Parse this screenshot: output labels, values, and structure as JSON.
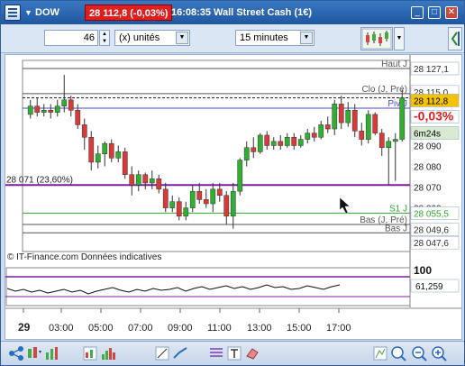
{
  "titlebar": {
    "symbol": "DOW",
    "price_change": "28 112,8 (-0,03%)",
    "time": "16:08:35",
    "name": "Wall Street Cash (1€)"
  },
  "toolbar": {
    "quantity": "46",
    "units": "(x) unités",
    "period": "15 minutes"
  },
  "chart_data": {
    "type": "candlestick",
    "x_ticks": [
      "29",
      "03:00",
      "05:00",
      "07:00",
      "09:00",
      "11:00",
      "13:00",
      "15:00",
      "17:00"
    ],
    "y_ticks": [
      "28 090",
      "28 080",
      "28 070",
      "28 060"
    ],
    "ylim": [
      28039,
      28131
    ],
    "candles": [
      {
        "o": 28105,
        "h": 28112,
        "l": 28103,
        "c": 28109
      },
      {
        "o": 28109,
        "h": 28113,
        "l": 28104,
        "c": 28106
      },
      {
        "o": 28106,
        "h": 28110,
        "l": 28104,
        "c": 28107
      },
      {
        "o": 28107,
        "h": 28110,
        "l": 28103,
        "c": 28106
      },
      {
        "o": 28106,
        "h": 28112,
        "l": 28104,
        "c": 28109
      },
      {
        "o": 28109,
        "h": 28124,
        "l": 28106,
        "c": 28112
      },
      {
        "o": 28112,
        "h": 28114,
        "l": 28104,
        "c": 28107
      },
      {
        "o": 28107,
        "h": 28110,
        "l": 28098,
        "c": 28100
      },
      {
        "o": 28100,
        "h": 28103,
        "l": 28088,
        "c": 28094
      },
      {
        "o": 28094,
        "h": 28097,
        "l": 28078,
        "c": 28082
      },
      {
        "o": 28082,
        "h": 28090,
        "l": 28079,
        "c": 28086
      },
      {
        "o": 28086,
        "h": 28092,
        "l": 28080,
        "c": 28091
      },
      {
        "o": 28091,
        "h": 28093,
        "l": 28082,
        "c": 28084
      },
      {
        "o": 28084,
        "h": 28090,
        "l": 28082,
        "c": 28087
      },
      {
        "o": 28087,
        "h": 28089,
        "l": 28074,
        "c": 28076
      },
      {
        "o": 28076,
        "h": 28080,
        "l": 28066,
        "c": 28071
      },
      {
        "o": 28071,
        "h": 28078,
        "l": 28068,
        "c": 28076
      },
      {
        "o": 28076,
        "h": 28077,
        "l": 28069,
        "c": 28072
      },
      {
        "o": 28072,
        "h": 28078,
        "l": 28069,
        "c": 28074
      },
      {
        "o": 28074,
        "h": 28076,
        "l": 28067,
        "c": 28069
      },
      {
        "o": 28069,
        "h": 28072,
        "l": 28058,
        "c": 28060
      },
      {
        "o": 28060,
        "h": 28066,
        "l": 28058,
        "c": 28063
      },
      {
        "o": 28063,
        "h": 28065,
        "l": 28054,
        "c": 28056
      },
      {
        "o": 28056,
        "h": 28063,
        "l": 28054,
        "c": 28060
      },
      {
        "o": 28060,
        "h": 28071,
        "l": 28058,
        "c": 28068
      },
      {
        "o": 28068,
        "h": 28072,
        "l": 28062,
        "c": 28064
      },
      {
        "o": 28064,
        "h": 28069,
        "l": 28060,
        "c": 28062
      },
      {
        "o": 28062,
        "h": 28072,
        "l": 28058,
        "c": 28069
      },
      {
        "o": 28069,
        "h": 28072,
        "l": 28063,
        "c": 28066
      },
      {
        "o": 28066,
        "h": 28068,
        "l": 28052,
        "c": 28056
      },
      {
        "o": 28056,
        "h": 28072,
        "l": 28050,
        "c": 28068
      },
      {
        "o": 28068,
        "h": 28084,
        "l": 28066,
        "c": 28083
      },
      {
        "o": 28083,
        "h": 28092,
        "l": 28080,
        "c": 28089
      },
      {
        "o": 28089,
        "h": 28094,
        "l": 28084,
        "c": 28087
      },
      {
        "o": 28087,
        "h": 28096,
        "l": 28086,
        "c": 28095
      },
      {
        "o": 28095,
        "h": 28097,
        "l": 28088,
        "c": 28090
      },
      {
        "o": 28090,
        "h": 28094,
        "l": 28088,
        "c": 28092
      },
      {
        "o": 28092,
        "h": 28095,
        "l": 28088,
        "c": 28090
      },
      {
        "o": 28090,
        "h": 28096,
        "l": 28089,
        "c": 28094
      },
      {
        "o": 28094,
        "h": 28096,
        "l": 28088,
        "c": 28090
      },
      {
        "o": 28090,
        "h": 28095,
        "l": 28089,
        "c": 28093
      },
      {
        "o": 28093,
        "h": 28098,
        "l": 28091,
        "c": 28096
      },
      {
        "o": 28096,
        "h": 28099,
        "l": 28092,
        "c": 28094
      },
      {
        "o": 28094,
        "h": 28102,
        "l": 28093,
        "c": 28100
      },
      {
        "o": 28100,
        "h": 28104,
        "l": 28096,
        "c": 28098
      },
      {
        "o": 28098,
        "h": 28112,
        "l": 28095,
        "c": 28110
      },
      {
        "o": 28110,
        "h": 28114,
        "l": 28098,
        "c": 28101
      },
      {
        "o": 28101,
        "h": 28111,
        "l": 28099,
        "c": 28107
      },
      {
        "o": 28107,
        "h": 28110,
        "l": 28094,
        "c": 28097
      },
      {
        "o": 28097,
        "h": 28101,
        "l": 28090,
        "c": 28093
      },
      {
        "o": 28093,
        "h": 28107,
        "l": 28091,
        "c": 28105
      },
      {
        "o": 28105,
        "h": 28106,
        "l": 28095,
        "c": 28096
      },
      {
        "o": 28096,
        "h": 28098,
        "l": 28085,
        "c": 28089
      },
      {
        "o": 28089,
        "h": 28094,
        "l": 28071,
        "c": 28092
      },
      {
        "o": 28092,
        "h": 28096,
        "l": 28073,
        "c": 28093
      },
      {
        "o": 28093,
        "h": 28117,
        "l": 28092,
        "c": 28113
      }
    ],
    "levels": [
      {
        "label": "Haut J",
        "value": 28127.1
      },
      {
        "label": "Clo (J, Pré)",
        "value": 28115.0
      },
      {
        "label": "Piv J",
        "value": 28108.0
      },
      {
        "label": "S1 J",
        "value": 28057.5
      },
      {
        "label": "Bas (J, Pré)",
        "value": 28052.0
      },
      {
        "label": "Bas J",
        "value": 28048.0
      }
    ],
    "fibo_label": "28 071 (23,60%)",
    "fibo_value": 28071,
    "right_tags": {
      "haut": "28 127,1",
      "clo": "28 115,0",
      "price": "28 112,8",
      "change": "-0,03%",
      "countdown": "6m24s",
      "s1": "28 055,5",
      "bas_pre": "28 049,6",
      "bas": "28 047,6"
    },
    "indicator": {
      "level": "100",
      "value": "61,259"
    },
    "footer": "© IT-Finance.com  Données indicatives"
  }
}
